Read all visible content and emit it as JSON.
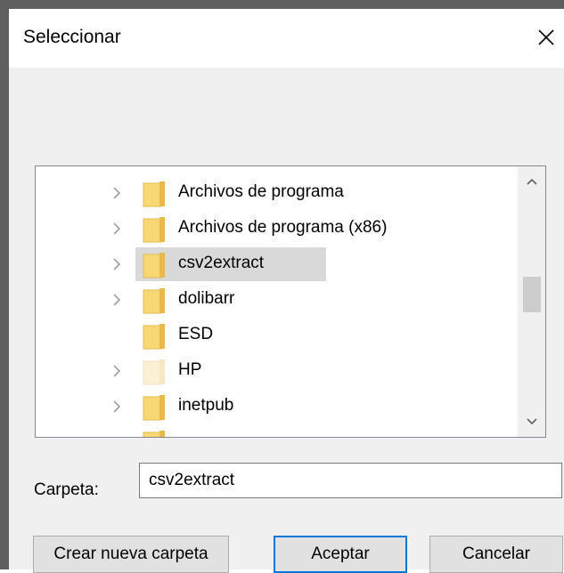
{
  "dialog": {
    "title": "Seleccionar",
    "close_icon": "close-icon"
  },
  "tree": {
    "items": [
      {
        "label": "Archivos de programa",
        "expandable": true,
        "selected": false,
        "folder_style": "normal"
      },
      {
        "label": "Archivos de programa (x86)",
        "expandable": true,
        "selected": false,
        "folder_style": "normal"
      },
      {
        "label": "csv2extract",
        "expandable": true,
        "selected": true,
        "folder_style": "normal"
      },
      {
        "label": "dolibarr",
        "expandable": true,
        "selected": false,
        "folder_style": "normal"
      },
      {
        "label": "ESD",
        "expandable": false,
        "selected": false,
        "folder_style": "normal"
      },
      {
        "label": "HP",
        "expandable": true,
        "selected": false,
        "folder_style": "faded"
      },
      {
        "label": "inetpub",
        "expandable": true,
        "selected": false,
        "folder_style": "normal"
      },
      {
        "label": "",
        "expandable": false,
        "selected": false,
        "folder_style": "normal"
      }
    ]
  },
  "folder_field": {
    "label": "Carpeta:",
    "value": "csv2extract"
  },
  "buttons": {
    "new_folder": "Crear nueva carpeta",
    "accept": "Aceptar",
    "cancel": "Cancelar"
  },
  "colors": {
    "selection": "#d9d9d9",
    "folder": "#f8d775",
    "primary_border": "#0078d7"
  }
}
